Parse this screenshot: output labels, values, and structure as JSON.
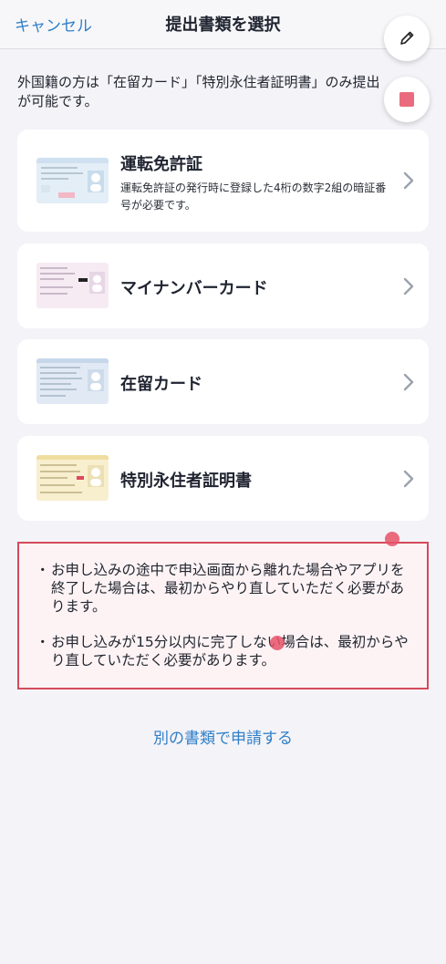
{
  "header": {
    "cancel_label": "キャンセル",
    "title": "提出書類を選択",
    "edit_icon": "pencil-icon",
    "stop_icon": "stop-square-icon"
  },
  "intro_text": "外国籍の方は「在留カード」「特別永住者証明書」のみ提出が可能です。",
  "documents": [
    {
      "name": "運転免許証",
      "description": "運転免許証の発行時に登録した4桁の数字2組の暗証番号が必要です。",
      "thumb_color": "#dfeaf5"
    },
    {
      "name": "マイナンバーカード",
      "description": "",
      "thumb_color": "#f4e6f0"
    },
    {
      "name": "在留カード",
      "description": "",
      "thumb_color": "#dde7f2"
    },
    {
      "name": "特別永住者証明書",
      "description": "",
      "thumb_color": "#f8eecc"
    }
  ],
  "notice": {
    "items": [
      "お申し込みの途中で申込画面から離れた場合やアプリを終了した場合は、最初からやり直していただく必要があります。",
      "お申し込みが15分以内に完了しない場合は、最初からやり直していただく必要があります。"
    ],
    "bullet": "・"
  },
  "alt_link_label": "別の書類で申請する",
  "colors": {
    "accent": "#2f7fc7",
    "notice_border": "#d44a5c",
    "background": "#f4f3f8"
  }
}
